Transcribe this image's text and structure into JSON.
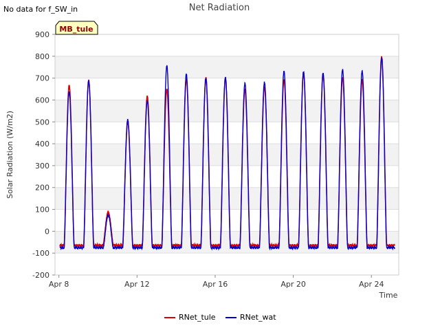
{
  "notice": "No data for f_SW_in",
  "site_tag": "MB_tule",
  "chart_data": {
    "type": "line",
    "title": "Net Radiation",
    "xlabel": "Time",
    "ylabel": "Solar Radiation (W/m2)",
    "ylim": [
      -200,
      900
    ],
    "yticks": [
      -200,
      -100,
      0,
      100,
      200,
      300,
      400,
      500,
      600,
      700,
      800,
      900
    ],
    "xlim_days": [
      7.8,
      25.4
    ],
    "xticks": [
      {
        "day": 8,
        "label": "Apr 8"
      },
      {
        "day": 12,
        "label": "Apr 12"
      },
      {
        "day": 16,
        "label": "Apr 16"
      },
      {
        "day": 20,
        "label": "Apr 20"
      },
      {
        "day": 24,
        "label": "Apr 24"
      }
    ],
    "grid": true,
    "legend_position": "bottom",
    "day_peaks": [
      {
        "day": 8,
        "tule": 665,
        "wat": 640
      },
      {
        "day": 9,
        "tule": 690,
        "wat": 690
      },
      {
        "day": 10,
        "tule": 90,
        "wat": 70
      },
      {
        "day": 11,
        "tule": 500,
        "wat": 510
      },
      {
        "day": 12,
        "tule": 615,
        "wat": 600
      },
      {
        "day": 13,
        "tule": 650,
        "wat": 755
      },
      {
        "day": 14,
        "tule": 700,
        "wat": 715
      },
      {
        "day": 15,
        "tule": 700,
        "wat": 700
      },
      {
        "day": 16,
        "tule": 700,
        "wat": 705
      },
      {
        "day": 17,
        "tule": 650,
        "wat": 675
      },
      {
        "day": 18,
        "tule": 660,
        "wat": 680
      },
      {
        "day": 19,
        "tule": 690,
        "wat": 735
      },
      {
        "day": 20,
        "tule": 725,
        "wat": 730
      },
      {
        "day": 21,
        "tule": 720,
        "wat": 720
      },
      {
        "day": 22,
        "tule": 700,
        "wat": 740
      },
      {
        "day": 23,
        "tule": 690,
        "wat": 735
      },
      {
        "day": 24,
        "tule": 800,
        "wat": 790
      }
    ],
    "night_level": {
      "tule": -65,
      "wat": -75
    },
    "series": [
      {
        "name": "RNet_tule",
        "color": "#dd0000"
      },
      {
        "name": "RNet_wat",
        "color": "#0000cc"
      }
    ]
  }
}
